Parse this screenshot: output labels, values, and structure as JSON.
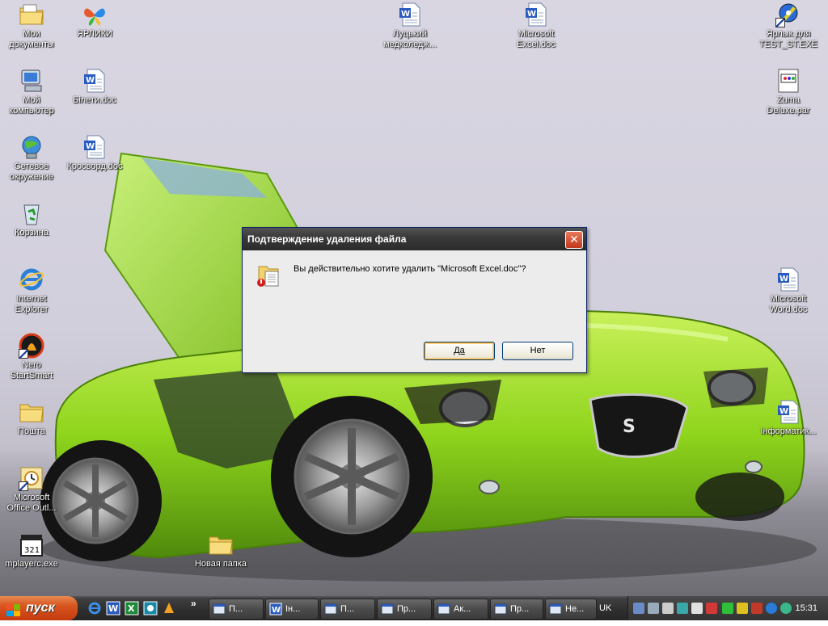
{
  "desktop": {
    "icons_left": [
      {
        "label": "Мои документы",
        "icon": "my-documents-icon"
      },
      {
        "label": "Мой компьютер",
        "icon": "my-computer-icon"
      },
      {
        "label": "Сетевое окружение",
        "icon": "network-icon"
      },
      {
        "label": "Корзина",
        "icon": "recycle-bin-icon"
      },
      {
        "label": "Internet Explorer",
        "icon": "ie-icon"
      },
      {
        "label": "Nero StartSmart",
        "icon": "nero-icon"
      },
      {
        "label": "Пошта",
        "icon": "folder-icon"
      },
      {
        "label": "Microsoft Office Outl...",
        "icon": "outlook-icon"
      },
      {
        "label": "mplayerc.exe",
        "icon": "mplayer-icon"
      }
    ],
    "icons_col2": [
      {
        "label": "ЯРЛИКИ",
        "icon": "butterfly-icon"
      },
      {
        "label": "Білети.doc",
        "icon": "word-doc-icon"
      },
      {
        "label": "Кросворд.doc",
        "icon": "word-doc-icon"
      }
    ],
    "icons_top": [
      {
        "label": "Луцький медколедж...",
        "icon": "word-doc-icon"
      },
      {
        "label": "Microsoft Excel.doc",
        "icon": "word-doc-icon"
      }
    ],
    "icons_right": [
      {
        "label": "Ярлык для TEST_ST.EXE",
        "icon": "test-shortcut-icon"
      },
      {
        "label": "Zuma Deluxe.par",
        "icon": "par-file-icon"
      },
      {
        "label": "Microsoft Word.doc",
        "icon": "word-doc-icon"
      },
      {
        "label": "Інформатик...",
        "icon": "word-doc-icon"
      }
    ],
    "icon_bottom": {
      "label": "Новая папка",
      "icon": "folder-icon"
    }
  },
  "dialog": {
    "title": "Подтверждение удаления файла",
    "message": "Вы действительно хотите удалить \"Microsoft Excel.doc\"?",
    "yes_label": "Да",
    "no_label": "Нет",
    "close_glyph": "✕"
  },
  "taskbar": {
    "start_label": "пуск",
    "chevron": "»",
    "buttons": [
      {
        "label": "П...",
        "icon": "explorer-window-icon"
      },
      {
        "label": "Ін...",
        "icon": "word-doc-icon"
      },
      {
        "label": "П...",
        "icon": "explorer-window-icon"
      },
      {
        "label": "Пр...",
        "icon": "explorer-window-icon"
      },
      {
        "label": "Ак...",
        "icon": "explorer-window-icon"
      },
      {
        "label": "Пр...",
        "icon": "explorer-window-icon"
      },
      {
        "label": "Не...",
        "icon": "explorer-window-icon"
      }
    ],
    "lang": "UK",
    "clock": "15:31"
  }
}
